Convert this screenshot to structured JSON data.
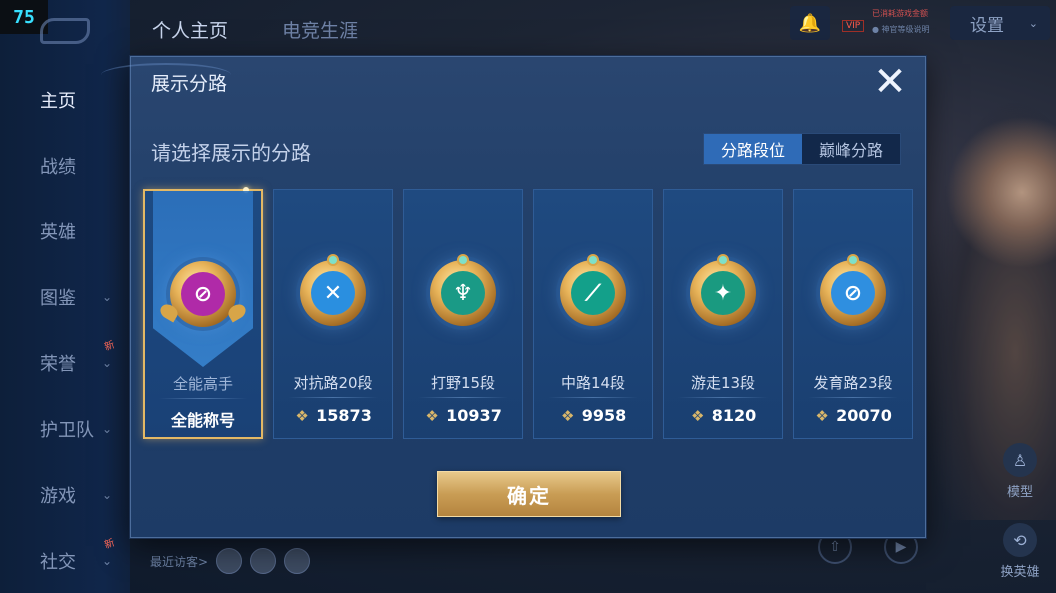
{
  "fps": "75",
  "top_tabs": [
    {
      "label": "个人主页",
      "active": true
    },
    {
      "label": "电竞生涯",
      "active": false
    }
  ],
  "sidebar": {
    "items": [
      {
        "label": "主页",
        "active": true
      },
      {
        "label": "战绩"
      },
      {
        "label": "英雄"
      },
      {
        "label": "图鉴",
        "chevron": "⌄"
      },
      {
        "label": "荣誉",
        "chevron": "⌄",
        "new_tag": "新"
      },
      {
        "label": "护卫队",
        "chevron": "⌄"
      },
      {
        "label": "游戏",
        "chevron": "⌄"
      },
      {
        "label": "社交",
        "chevron": "⌄",
        "new_tag": "新"
      }
    ]
  },
  "topright": {
    "vip_tag": "VIP",
    "vip_line1": "已消耗游戏金额",
    "vip_line2": "● 神官等级说明",
    "settings_label": "设置",
    "settings_chevron": "⌄"
  },
  "right_actions": {
    "model_label": "模型",
    "swap_label": "换英雄"
  },
  "visitors_label": "最近访客>",
  "modal": {
    "title": "展示分路",
    "close_glyph": "✕",
    "subtitle": "请选择展示的分路",
    "segments": [
      {
        "label": "分路段位",
        "active": true
      },
      {
        "label": "巅峰分路",
        "active": false
      }
    ],
    "cards": [
      {
        "name": "全能高手",
        "score": "全能称号",
        "emblem_color": "#b02aa8",
        "emblem_glyph": "⊘",
        "selected": true,
        "show_diamond": false
      },
      {
        "name": "对抗路20段",
        "score": "15873",
        "emblem_color": "#2a8fe0",
        "emblem_glyph": "✕",
        "selected": false,
        "show_diamond": true
      },
      {
        "name": "打野15段",
        "score": "10937",
        "emblem_color": "#1a9a86",
        "emblem_glyph": "♆",
        "selected": false,
        "show_diamond": true
      },
      {
        "name": "中路14段",
        "score": "9958",
        "emblem_color": "#13a08a",
        "emblem_glyph": "⟋",
        "selected": false,
        "show_diamond": true
      },
      {
        "name": "游走13段",
        "score": "8120",
        "emblem_color": "#1a9a80",
        "emblem_glyph": "✦",
        "selected": false,
        "show_diamond": true
      },
      {
        "name": "发育路23段",
        "score": "20070",
        "emblem_color": "#2f8fe0",
        "emblem_glyph": "⊘",
        "selected": false,
        "show_diamond": true
      }
    ],
    "diamond_glyph": "❖",
    "confirm_label": "确定"
  },
  "colors": {
    "accent_gold": "#e3b865",
    "segment_active": "#2f6bb7",
    "modal_bg": "#22406a"
  }
}
